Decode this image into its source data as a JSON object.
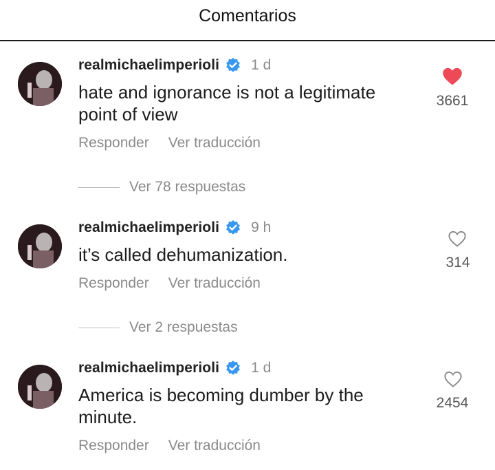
{
  "header": {
    "title": "Comentarios"
  },
  "comments": [
    {
      "username": "realmichaelimperioli",
      "time": "1 d",
      "text": "hate and ignorance is not a legitimate point of view",
      "reply_label": "Responder",
      "translate_label": "Ver traducción",
      "likes": "3661",
      "liked": true,
      "view_replies": "Ver 78 respuestas"
    },
    {
      "username": "realmichaelimperioli",
      "time": "9 h",
      "text": "it’s called dehumanization.",
      "reply_label": "Responder",
      "translate_label": "Ver traducción",
      "likes": "314",
      "liked": false,
      "view_replies": "Ver 2 respuestas"
    },
    {
      "username": "realmichaelimperioli",
      "time": "1 d",
      "text": "America is becoming dumber by the minute.",
      "reply_label": "Responder",
      "translate_label": "Ver traducción",
      "likes": "2454",
      "liked": false
    }
  ],
  "colors": {
    "like_red": "#ed4956",
    "verified_blue": "#3897f0",
    "muted": "#8a8a8a"
  }
}
